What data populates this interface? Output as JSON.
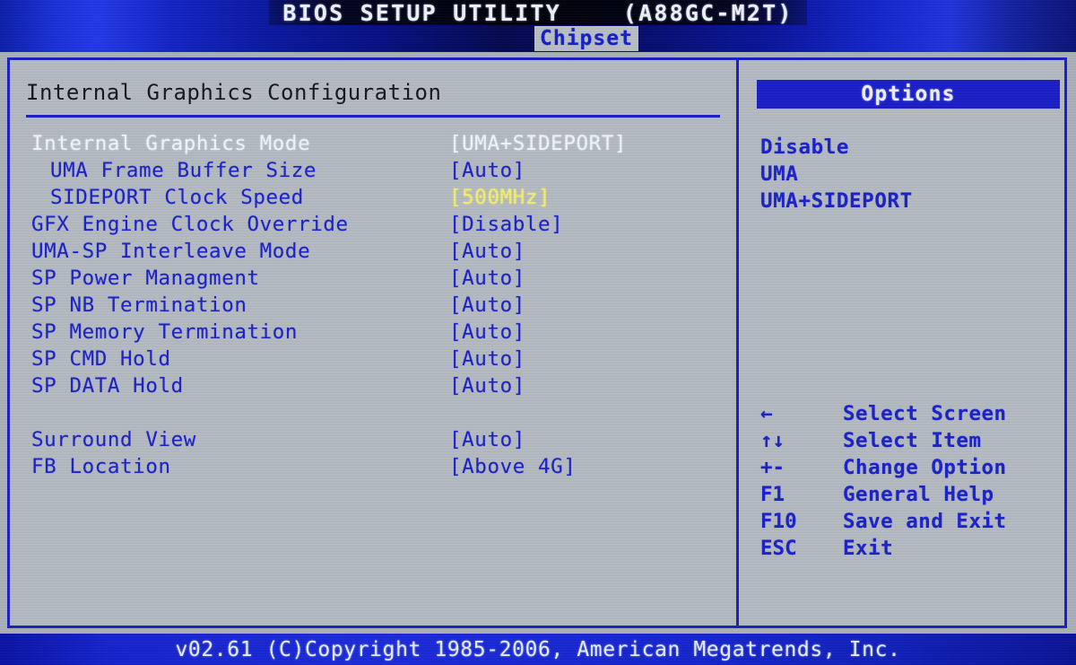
{
  "header": {
    "title": "BIOS SETUP UTILITY    (A88GC-M2T)",
    "active_tab": "Chipset"
  },
  "main": {
    "heading": "Internal Graphics Configuration",
    "rows": [
      {
        "label": "Internal Graphics Mode",
        "value": "[UMA+SIDEPORT]",
        "indent": 0,
        "selected": true,
        "highlight": false
      },
      {
        "label": "UMA Frame Buffer Size",
        "value": "[Auto]",
        "indent": 1,
        "selected": false,
        "highlight": false
      },
      {
        "label": "SIDEPORT Clock Speed",
        "value": "[500MHz]",
        "indent": 1,
        "selected": false,
        "highlight": true
      },
      {
        "label": "GFX Engine Clock Override",
        "value": "[Disable]",
        "indent": 0,
        "selected": false,
        "highlight": false
      },
      {
        "label": "UMA-SP Interleave Mode",
        "value": "[Auto]",
        "indent": 0,
        "selected": false,
        "highlight": false
      },
      {
        "label": "SP Power Managment",
        "value": "[Auto]",
        "indent": 0,
        "selected": false,
        "highlight": false
      },
      {
        "label": "SP NB Termination",
        "value": "[Auto]",
        "indent": 0,
        "selected": false,
        "highlight": false
      },
      {
        "label": "SP Memory Termination",
        "value": "[Auto]",
        "indent": 0,
        "selected": false,
        "highlight": false
      },
      {
        "label": "SP CMD Hold",
        "value": "[Auto]",
        "indent": 0,
        "selected": false,
        "highlight": false
      },
      {
        "label": "SP DATA Hold",
        "value": "[Auto]",
        "indent": 0,
        "selected": false,
        "highlight": false
      },
      {
        "spacer": true
      },
      {
        "label": "Surround View",
        "value": "[Auto]",
        "indent": 0,
        "selected": false,
        "highlight": false
      },
      {
        "label": "FB Location",
        "value": "[Above 4G]",
        "indent": 0,
        "selected": false,
        "highlight": false
      }
    ]
  },
  "options": {
    "title": "Options",
    "items": [
      "Disable",
      "UMA",
      "UMA+SIDEPORT"
    ]
  },
  "keys": [
    {
      "key": "←",
      "desc": "Select Screen",
      "icon": "left-arrow-icon"
    },
    {
      "key": "↑↓",
      "desc": "Select Item",
      "icon": "up-down-arrow-icon"
    },
    {
      "key": "+-",
      "desc": "Change Option",
      "icon": "plus-minus-icon"
    },
    {
      "key": "F1",
      "desc": "General Help",
      "icon": "f1-key-icon"
    },
    {
      "key": "F10",
      "desc": "Save and Exit",
      "icon": "f10-key-icon"
    },
    {
      "key": "ESC",
      "desc": "Exit",
      "icon": "esc-key-icon"
    }
  ],
  "footer": {
    "text": "v02.61 (C)Copyright 1985-2006, American Megatrends, Inc."
  },
  "colors": {
    "screen_bg": "#b4bac1",
    "blue": "#1b22c9",
    "border_blue": "#1b1fc6",
    "selected_white": "#f2f5f8",
    "highlight_yellow": "#f2f06a",
    "heading_dark": "#14181f"
  }
}
